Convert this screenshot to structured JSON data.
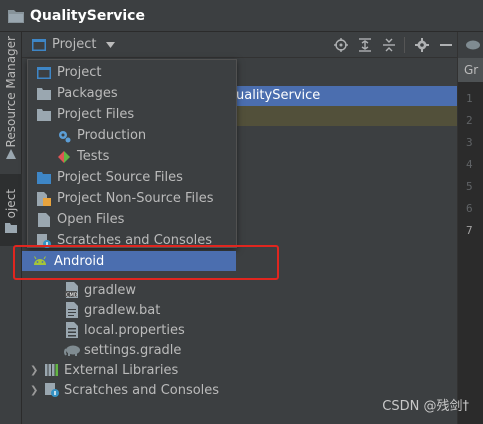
{
  "window": {
    "title": "QualityService"
  },
  "sidebar": {
    "tabs": [
      {
        "label": "Resource Manager"
      },
      {
        "label": "Project"
      }
    ]
  },
  "toolbar": {
    "view_label": "Project"
  },
  "tree": {
    "selected_partial": "ualityService",
    "items": [
      {
        "label": "gradlew"
      },
      {
        "label": "gradlew.bat"
      },
      {
        "label": "local.properties"
      },
      {
        "label": "settings.gradle"
      },
      {
        "label": "External Libraries"
      },
      {
        "label": "Scratches and Consoles"
      }
    ]
  },
  "dropdown": {
    "items": [
      {
        "label": "Project"
      },
      {
        "label": "Packages"
      },
      {
        "label": "Project Files"
      },
      {
        "label": "Production"
      },
      {
        "label": "Tests"
      },
      {
        "label": "Project Source Files"
      },
      {
        "label": "Project Non-Source Files"
      },
      {
        "label": "Open Files"
      },
      {
        "label": "Scratches and Consoles"
      }
    ],
    "highlighted": "Android"
  },
  "editor": {
    "tab_label": "Gr",
    "lines": [
      "1",
      "2",
      "3",
      "4",
      "5",
      "6",
      "7"
    ]
  },
  "watermark": "CSDN @残剑†",
  "colors": {
    "background": "#3c3f41",
    "selection": "#4b6eaf",
    "highlight_box": "#e0261f",
    "android_green": "#a4c639"
  }
}
